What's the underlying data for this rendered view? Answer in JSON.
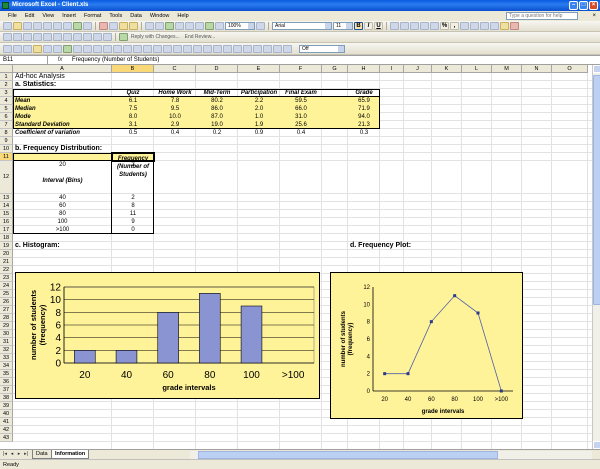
{
  "window": {
    "title": "Microsoft Excel - Client.xls"
  },
  "menu": {
    "items": [
      "File",
      "Edit",
      "View",
      "Insert",
      "Format",
      "Tools",
      "Data",
      "Window",
      "Help"
    ],
    "help_placeholder": "Type a question for help"
  },
  "toolbar": {
    "zoom": "100%",
    "font": "Arial",
    "size": "11",
    "bold": "B",
    "italic": "I",
    "underline": "U",
    "percent": "%",
    "comma": ",",
    "reply": "Reply with Changes...",
    "end_review": "End Review...",
    "fill_combo": "Off"
  },
  "formula_bar": {
    "name_box": "B11",
    "fx": "fx",
    "content": "Frequency (Number of Students)"
  },
  "columns": [
    "A",
    "B",
    "C",
    "D",
    "E",
    "F",
    "G",
    "H",
    "I",
    "J",
    "K",
    "L",
    "M",
    "N",
    "O"
  ],
  "rows": [
    "1",
    "2",
    "3",
    "4",
    "5",
    "6",
    "7",
    "8",
    "9",
    "10",
    "11",
    "12",
    "13",
    "14",
    "15",
    "16",
    "17",
    "18",
    "19",
    "20",
    "21",
    "22",
    "23",
    "24",
    "25",
    "26",
    "27",
    "28",
    "29",
    "30",
    "31",
    "32",
    "33",
    "34",
    "35",
    "36",
    "37",
    "38",
    "39",
    "40",
    "41",
    "42",
    "43"
  ],
  "sheet": {
    "title": "Ad-hoc Analysis",
    "stats_heading": "a. Statistics:",
    "stats_columns": [
      "Quiz",
      "Home Work",
      "Mid-Term",
      "Participation",
      "Final Exam",
      "Grade"
    ],
    "stats_rows": [
      {
        "label": "Mean",
        "values": [
          "6.1",
          "7.8",
          "80.2",
          "2.2",
          "59.5",
          "65.9"
        ]
      },
      {
        "label": "Median",
        "values": [
          "7.5",
          "9.5",
          "86.0",
          "2.0",
          "66.0",
          "71.9"
        ]
      },
      {
        "label": "Mode",
        "values": [
          "8.0",
          "10.0",
          "87.0",
          "1.0",
          "31.0",
          "94.0"
        ]
      },
      {
        "label": "Standard Deviation",
        "values": [
          "3.1",
          "2.9",
          "19.0",
          "1.9",
          "25.6",
          "21.3"
        ]
      },
      {
        "label": "Coefficient of variation",
        "values": [
          "0.5",
          "0.4",
          "0.2",
          "0.9",
          "0.4",
          "0.3"
        ]
      }
    ],
    "freq_heading": "b. Frequency Distribution:",
    "freq_col_bins": "Interval (Bins)",
    "freq_col_freq_lines": [
      "Frequency",
      "(Number of",
      "Students)"
    ],
    "freq_rows": [
      {
        "bin": "20",
        "freq": "2"
      },
      {
        "bin": "40",
        "freq": "2"
      },
      {
        "bin": "60",
        "freq": "8"
      },
      {
        "bin": "80",
        "freq": "11"
      },
      {
        "bin": "100",
        "freq": "9"
      },
      {
        "bin": ">100",
        "freq": "0"
      }
    ],
    "hist_heading": "c. Histogram:",
    "plot_heading": "d. Frequency Plot:"
  },
  "chart_data": [
    {
      "type": "bar",
      "categories": [
        "20",
        "40",
        "60",
        "80",
        "100",
        ">100"
      ],
      "values": [
        2,
        2,
        8,
        11,
        9,
        0
      ],
      "xlabel": "grade intervals",
      "ylabel": "number of students (frequency)",
      "ylim": [
        0,
        12
      ],
      "yticks": [
        0,
        2,
        4,
        6,
        8,
        10,
        12
      ],
      "grid": true,
      "legend": "none",
      "color": "#8a94d2"
    },
    {
      "type": "line",
      "categories": [
        "20",
        "40",
        "60",
        "80",
        "100",
        ">100"
      ],
      "values": [
        2,
        2,
        8,
        11,
        9,
        0
      ],
      "xlabel": "grade intervals",
      "ylabel": "number of students (frequency)",
      "ylim": [
        0,
        12
      ],
      "yticks": [
        0,
        2,
        4,
        6,
        8,
        10,
        12
      ],
      "grid": false,
      "legend": "none",
      "color": "#2a3a8a"
    }
  ],
  "tabs": {
    "items": [
      "Data",
      "Information"
    ],
    "active": "Information"
  },
  "status": {
    "text": "Ready"
  }
}
